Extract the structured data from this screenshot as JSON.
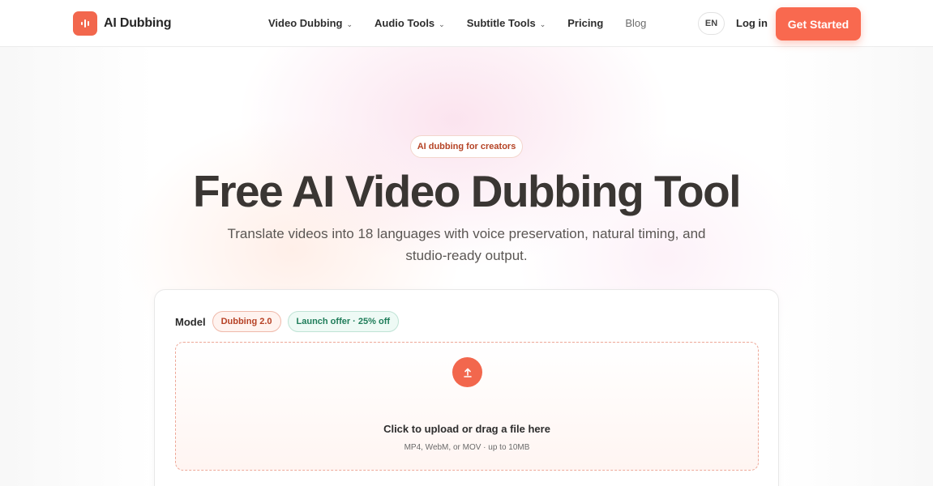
{
  "brand": {
    "name": "AI Dubbing",
    "logo_icon": "waveform-icon",
    "accent": "#f2674d"
  },
  "nav": {
    "items": [
      {
        "label": "Video Dubbing",
        "has_dropdown": true
      },
      {
        "label": "Audio Tools",
        "has_dropdown": true
      },
      {
        "label": "Subtitle Tools",
        "has_dropdown": true
      },
      {
        "label": "Pricing",
        "has_dropdown": false
      },
      {
        "label": "Blog",
        "has_dropdown": false
      }
    ],
    "chevron": "⌄"
  },
  "header_actions": {
    "language": "EN",
    "login_label": "Log in",
    "cta_label": "Get Started",
    "cta_color": "#f9694f"
  },
  "hero": {
    "tag": "AI dubbing for creators",
    "title": "Free AI Video Dubbing Tool",
    "subtitle_line1": "Translate videos into 18 languages with voice preservation, natural timing, and",
    "subtitle_line2": "studio-ready output."
  },
  "upload_card": {
    "model_label": "Model",
    "model_value": "Dubbing 2.0",
    "offer_badge": "Launch offer · 25% off",
    "upload_icon": "upload-arrow-icon",
    "drop_title": "Click to upload or drag a file here",
    "drop_hint": "MP4, WebM, or MOV · up to 10MB"
  }
}
